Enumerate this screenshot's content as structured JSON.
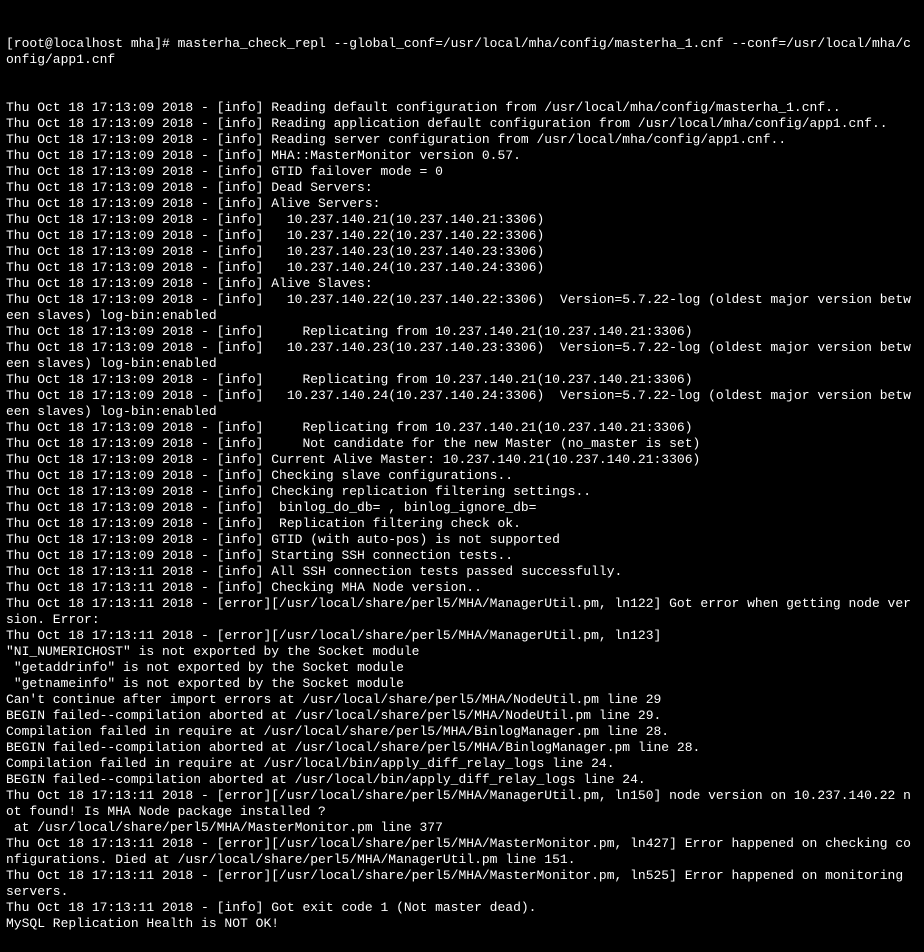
{
  "prompt": "[root@localhost mha]# masterha_check_repl --global_conf=/usr/local/mha/config/masterha_1.cnf --conf=/usr/local/mha/config/app1.cnf",
  "lines": [
    "Thu Oct 18 17:13:09 2018 - [info] Reading default configuration from /usr/local/mha/config/masterha_1.cnf..",
    "Thu Oct 18 17:13:09 2018 - [info] Reading application default configuration from /usr/local/mha/config/app1.cnf..",
    "Thu Oct 18 17:13:09 2018 - [info] Reading server configuration from /usr/local/mha/config/app1.cnf..",
    "Thu Oct 18 17:13:09 2018 - [info] MHA::MasterMonitor version 0.57.",
    "Thu Oct 18 17:13:09 2018 - [info] GTID failover mode = 0",
    "Thu Oct 18 17:13:09 2018 - [info] Dead Servers:",
    "Thu Oct 18 17:13:09 2018 - [info] Alive Servers:",
    "Thu Oct 18 17:13:09 2018 - [info]   10.237.140.21(10.237.140.21:3306)",
    "Thu Oct 18 17:13:09 2018 - [info]   10.237.140.22(10.237.140.22:3306)",
    "Thu Oct 18 17:13:09 2018 - [info]   10.237.140.23(10.237.140.23:3306)",
    "Thu Oct 18 17:13:09 2018 - [info]   10.237.140.24(10.237.140.24:3306)",
    "Thu Oct 18 17:13:09 2018 - [info] Alive Slaves:",
    "Thu Oct 18 17:13:09 2018 - [info]   10.237.140.22(10.237.140.22:3306)  Version=5.7.22-log (oldest major version between slaves) log-bin:enabled",
    "Thu Oct 18 17:13:09 2018 - [info]     Replicating from 10.237.140.21(10.237.140.21:3306)",
    "Thu Oct 18 17:13:09 2018 - [info]   10.237.140.23(10.237.140.23:3306)  Version=5.7.22-log (oldest major version between slaves) log-bin:enabled",
    "Thu Oct 18 17:13:09 2018 - [info]     Replicating from 10.237.140.21(10.237.140.21:3306)",
    "Thu Oct 18 17:13:09 2018 - [info]   10.237.140.24(10.237.140.24:3306)  Version=5.7.22-log (oldest major version between slaves) log-bin:enabled",
    "Thu Oct 18 17:13:09 2018 - [info]     Replicating from 10.237.140.21(10.237.140.21:3306)",
    "Thu Oct 18 17:13:09 2018 - [info]     Not candidate for the new Master (no_master is set)",
    "Thu Oct 18 17:13:09 2018 - [info] Current Alive Master: 10.237.140.21(10.237.140.21:3306)",
    "Thu Oct 18 17:13:09 2018 - [info] Checking slave configurations..",
    "Thu Oct 18 17:13:09 2018 - [info] Checking replication filtering settings..",
    "Thu Oct 18 17:13:09 2018 - [info]  binlog_do_db= , binlog_ignore_db=",
    "Thu Oct 18 17:13:09 2018 - [info]  Replication filtering check ok.",
    "Thu Oct 18 17:13:09 2018 - [info] GTID (with auto-pos) is not supported",
    "Thu Oct 18 17:13:09 2018 - [info] Starting SSH connection tests..",
    "Thu Oct 18 17:13:11 2018 - [info] All SSH connection tests passed successfully.",
    "Thu Oct 18 17:13:11 2018 - [info] Checking MHA Node version..",
    "Thu Oct 18 17:13:11 2018 - [error][/usr/local/share/perl5/MHA/ManagerUtil.pm, ln122] Got error when getting node version. Error:",
    "Thu Oct 18 17:13:11 2018 - [error][/usr/local/share/perl5/MHA/ManagerUtil.pm, ln123]",
    "\"NI_NUMERICHOST\" is not exported by the Socket module",
    " \"getaddrinfo\" is not exported by the Socket module",
    " \"getnameinfo\" is not exported by the Socket module",
    "Can't continue after import errors at /usr/local/share/perl5/MHA/NodeUtil.pm line 29",
    "BEGIN failed--compilation aborted at /usr/local/share/perl5/MHA/NodeUtil.pm line 29.",
    "Compilation failed in require at /usr/local/share/perl5/MHA/BinlogManager.pm line 28.",
    "BEGIN failed--compilation aborted at /usr/local/share/perl5/MHA/BinlogManager.pm line 28.",
    "Compilation failed in require at /usr/local/bin/apply_diff_relay_logs line 24.",
    "BEGIN failed--compilation aborted at /usr/local/bin/apply_diff_relay_logs line 24.",
    "Thu Oct 18 17:13:11 2018 - [error][/usr/local/share/perl5/MHA/ManagerUtil.pm, ln150] node version on 10.237.140.22 not found! Is MHA Node package installed ?",
    " at /usr/local/share/perl5/MHA/MasterMonitor.pm line 377",
    "Thu Oct 18 17:13:11 2018 - [error][/usr/local/share/perl5/MHA/MasterMonitor.pm, ln427] Error happened on checking configurations. Died at /usr/local/share/perl5/MHA/ManagerUtil.pm line 151.",
    "Thu Oct 18 17:13:11 2018 - [error][/usr/local/share/perl5/MHA/MasterMonitor.pm, ln525] Error happened on monitoring servers.",
    "Thu Oct 18 17:13:11 2018 - [info] Got exit code 1 (Not master dead).",
    "",
    "MySQL Replication Health is NOT OK!"
  ]
}
